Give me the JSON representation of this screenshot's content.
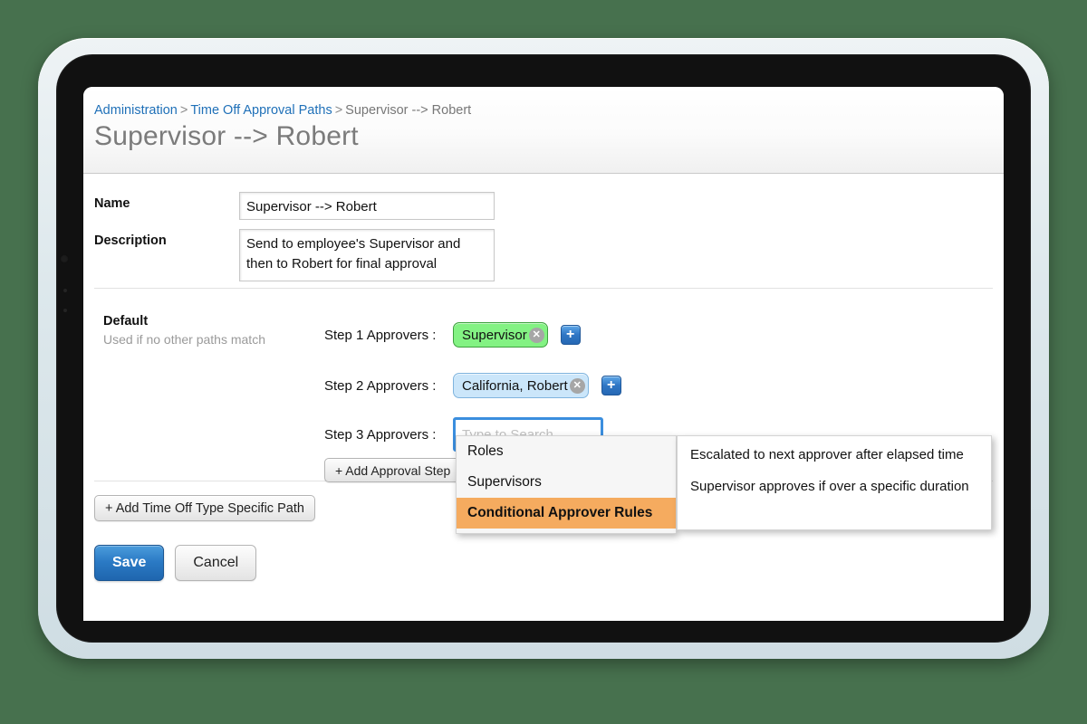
{
  "breadcrumb": {
    "item1": "Administration",
    "sep1": ">",
    "item2": "Time Off Approval Paths",
    "sep2": ">",
    "item3": "Supervisor --> Robert"
  },
  "page": {
    "title": "Supervisor --> Robert"
  },
  "form": {
    "name_label": "Name",
    "name_value": "Supervisor --> Robert",
    "description_label": "Description",
    "description_value": "Send to employee's Supervisor and then to Robert for final approval"
  },
  "default_path": {
    "title": "Default",
    "subtitle": "Used if no other paths match",
    "steps": [
      {
        "label": "Step 1 Approvers :",
        "token": "Supervisor",
        "token_style": "green",
        "remove_icon": "✕",
        "add_icon": "+"
      },
      {
        "label": "Step 2 Approvers :",
        "token": "California, Robert",
        "token_style": "blue",
        "remove_icon": "✕",
        "add_icon": "+"
      },
      {
        "label": "Step 3 Approvers :",
        "input_value": "",
        "input_placeholder": "Type to Search"
      }
    ],
    "add_step_label": "+ Add Approval Step"
  },
  "add_path_label": "+ Add Time Off Type Specific Path",
  "footer": {
    "save_label": "Save",
    "cancel_label": "Cancel"
  },
  "dropdown": {
    "items": [
      {
        "label": "Roles",
        "active": false
      },
      {
        "label": "Supervisors",
        "active": false
      },
      {
        "label": "Conditional Approver Rules",
        "active": true
      }
    ]
  },
  "submenu": {
    "items": [
      {
        "label": "Escalated to next approver after elapsed time"
      },
      {
        "label": "Supervisor approves if over a specific duration"
      }
    ]
  },
  "colors": {
    "background": "#47714e",
    "link": "#1f70b8",
    "accent_orange": "#f5ab5f",
    "token_green": "#83f283",
    "token_blue": "#cbe6fa",
    "focus_blue": "#3b8ede",
    "save_blue": "#2a79c4"
  }
}
